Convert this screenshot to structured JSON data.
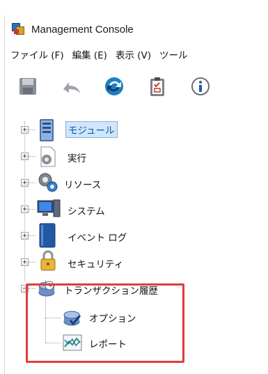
{
  "window": {
    "title": "Management Console"
  },
  "menu": [
    "ファイル (F)",
    "編集 (E)",
    "表示 (V)",
    "ツール"
  ],
  "toolbar": {
    "buttons": [
      {
        "name": "save-button",
        "icon": "floppy-disk-icon"
      },
      {
        "name": "undo-button",
        "icon": "undo-arrow-icon"
      },
      {
        "name": "refresh-button",
        "icon": "refresh-icon"
      },
      {
        "name": "clipboard-button",
        "icon": "clipboard-icon"
      },
      {
        "name": "info-button",
        "icon": "info-icon"
      }
    ]
  },
  "tree": {
    "modules": "モジュール",
    "execute": "実行",
    "resources": "リソース",
    "system": "システム",
    "event_log": "イベント ログ",
    "security": "セキュリティ",
    "transaction_history": "トランザクション履歴",
    "options": "オプション",
    "report": "レポート"
  },
  "colors": {
    "highlight": "#e03c3c",
    "selection": "#cfe6fb"
  }
}
